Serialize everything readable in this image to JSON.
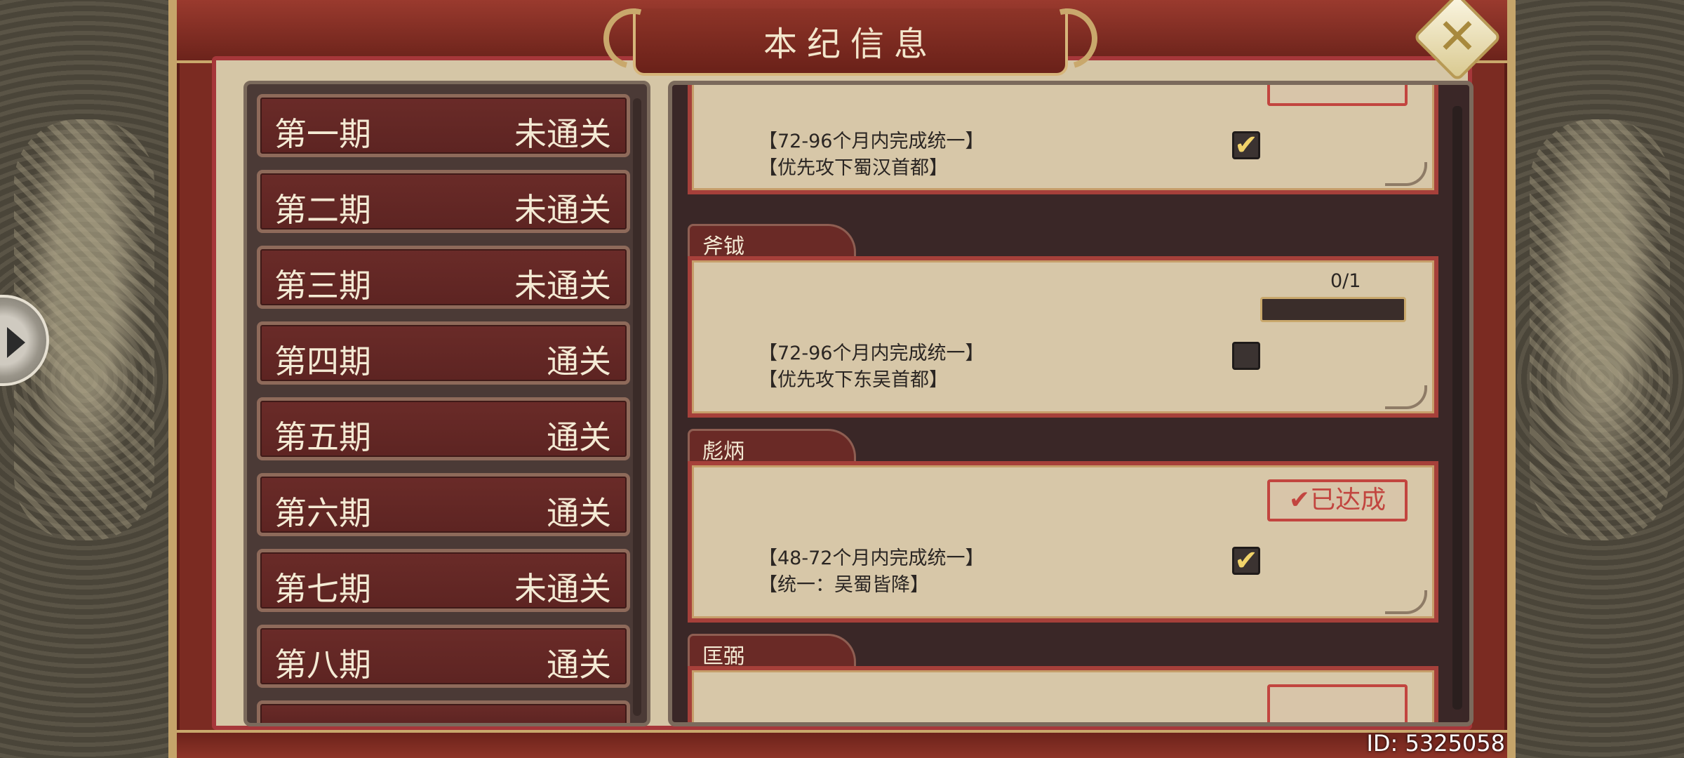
{
  "title": "本纪信息",
  "close_symbol": "✕",
  "periods": [
    {
      "name": "第一期",
      "status": "未通关"
    },
    {
      "name": "第二期",
      "status": "未通关"
    },
    {
      "name": "第三期",
      "status": "未通关"
    },
    {
      "name": "第四期",
      "status": "通关"
    },
    {
      "name": "第五期",
      "status": "通关"
    },
    {
      "name": "第六期",
      "status": "通关"
    },
    {
      "name": "第七期",
      "status": "未通关"
    },
    {
      "name": "第八期",
      "status": "通关"
    }
  ],
  "tasks": [
    {
      "tab": "",
      "line1": "【72-96个月内完成统一】",
      "line2": "【优先攻下蜀汉首都】",
      "checked": true,
      "achieved": true
    },
    {
      "tab": "斧钺",
      "line1": "【72-96个月内完成统一】",
      "line2": "【优先攻下东吴首都】",
      "checked": false,
      "progress_text": "0/1",
      "progress": 0
    },
    {
      "tab": "彪炳",
      "line1": "【48-72个月内完成统一】",
      "line2": "【统一：吴蜀皆降】",
      "checked": true,
      "achieved": true,
      "stamp": "✔已达成"
    },
    {
      "tab": "匡弼",
      "line1": "",
      "line2": "",
      "checked": true,
      "achieved": true
    }
  ],
  "check_mark": "✔",
  "player_id": "ID: 5325058",
  "colors": {
    "frame_red": "#7b2b22",
    "gold": "#c9a86c",
    "parchment": "#d7c7a8",
    "stamp_red": "#c2453f",
    "check_yellow": "#f1d36a"
  }
}
